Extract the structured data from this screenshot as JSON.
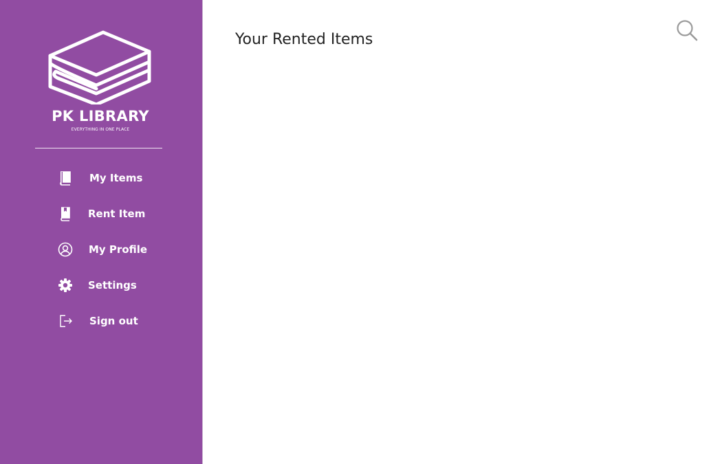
{
  "app": {
    "brand_name": "PK LIBRARY",
    "tagline": "EVERYTHING IN ONE PLACE",
    "logo_icon": "stacked-books-icon"
  },
  "sidebar": {
    "background_color": "#914ca2",
    "items": [
      {
        "label": "My Items",
        "icon": "book-icon"
      },
      {
        "label": "Rent Item",
        "icon": "bookmark-book-icon"
      },
      {
        "label": "My Profile",
        "icon": "user-circle-icon"
      },
      {
        "label": "Settings",
        "icon": "gear-icon"
      },
      {
        "label": "Sign out",
        "icon": "sign-out-icon"
      }
    ]
  },
  "main": {
    "title": "Your Rented Items",
    "search_icon": "search-icon"
  }
}
